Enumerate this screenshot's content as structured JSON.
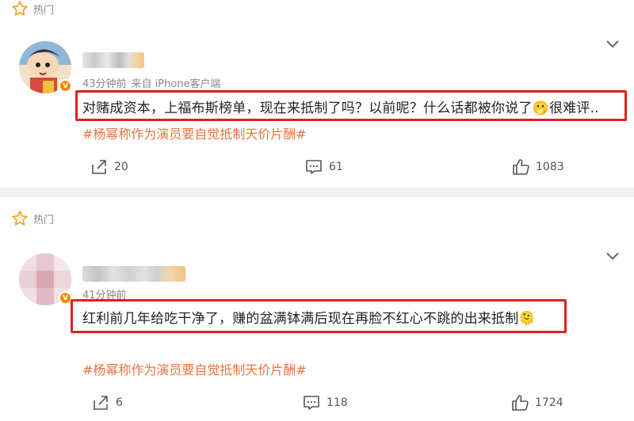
{
  "section_label": "热门",
  "posts": [
    {
      "time": "43分钟前",
      "source": "来自 iPhone客户端",
      "comment": "对赌成资本，上福布斯榜单，现在来抵制了吗？以前呢？什么话都被你说了🫢很难评..",
      "hashtag": "#杨幂称作为演员要自觉抵制天价片酬#",
      "shares": "20",
      "comments": "61",
      "likes": "1083"
    },
    {
      "time": "41分钟前",
      "comment": "红利前几年给吃干净了，赚的盆满钵满后现在再脸不红心不跳的出来抵制🫠",
      "hashtag": "#杨幂称作为演员要自觉抵制天价片酬#",
      "shares": "6",
      "comments": "118",
      "likes": "1724"
    }
  ],
  "colors": {
    "highlight_border": "#e02020",
    "hashtag": "#eb7340",
    "star": "#f0a020",
    "verified_badge": "#f28b00"
  },
  "icons": [
    "star-icon",
    "chevron-down-icon",
    "share-icon",
    "comment-icon",
    "like-icon",
    "verified-badge-icon"
  ]
}
